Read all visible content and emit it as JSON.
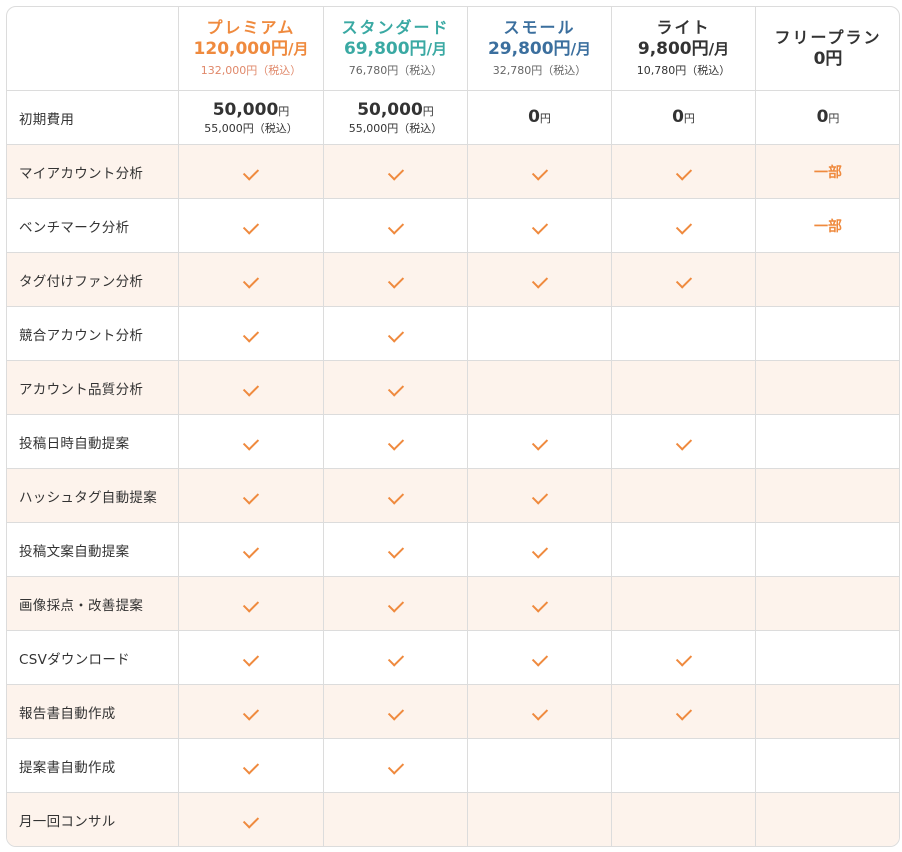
{
  "colors": {
    "accent_orange": "#ef8a3e",
    "standard_teal": "#3aa9a3",
    "small_blue": "#3b6f9e",
    "dark_text": "#333333",
    "stripe_bg": "#fdf3ec",
    "border": "#dcdcdc"
  },
  "plans": [
    {
      "name": "プレミアム",
      "price": "120,000円",
      "unit": "/月",
      "tax": "132,000円（税込）",
      "color": "#ef8a3e",
      "tax_color": "#e0886a"
    },
    {
      "name": "スタンダード",
      "price": "69,800円",
      "unit": "/月",
      "tax": "76,780円（税込）",
      "color": "#3aa9a3",
      "tax_color": "#666666"
    },
    {
      "name": "スモール",
      "price": "29,800円",
      "unit": "/月",
      "tax": "32,780円（税込）",
      "color": "#3b6f9e",
      "tax_color": "#666666"
    },
    {
      "name": "ライト",
      "price": "9,800円",
      "unit": "/月",
      "tax": "10,780円（税込）",
      "color": "#333333",
      "tax_color": "#333333"
    },
    {
      "name": "フリープラン",
      "price": "0円",
      "unit": "",
      "tax": "",
      "color": "#333333",
      "tax_color": "#333333"
    }
  ],
  "initial_fee": {
    "label": "初期費用",
    "values": [
      {
        "amount": "50,000",
        "yen": "円",
        "tax": "55,000円（税込）"
      },
      {
        "amount": "50,000",
        "yen": "円",
        "tax": "55,000円（税込）"
      },
      {
        "amount": "0",
        "yen": "円",
        "tax": ""
      },
      {
        "amount": "0",
        "yen": "円",
        "tax": ""
      },
      {
        "amount": "0",
        "yen": "円",
        "tax": ""
      }
    ]
  },
  "partial_label": "一部",
  "check_icon": "check-icon",
  "features": [
    {
      "label": "マイアカウント分析",
      "cells": [
        "check",
        "check",
        "check",
        "check",
        "partial"
      ]
    },
    {
      "label": "ベンチマーク分析",
      "cells": [
        "check",
        "check",
        "check",
        "check",
        "partial"
      ]
    },
    {
      "label": "タグ付けファン分析",
      "cells": [
        "check",
        "check",
        "check",
        "check",
        ""
      ]
    },
    {
      "label": "競合アカウント分析",
      "cells": [
        "check",
        "check",
        "",
        "",
        ""
      ]
    },
    {
      "label": "アカウント品質分析",
      "cells": [
        "check",
        "check",
        "",
        "",
        ""
      ]
    },
    {
      "label": "投稿日時自動提案",
      "cells": [
        "check",
        "check",
        "check",
        "check",
        ""
      ]
    },
    {
      "label": "ハッシュタグ自動提案",
      "cells": [
        "check",
        "check",
        "check",
        "",
        ""
      ]
    },
    {
      "label": "投稿文案自動提案",
      "cells": [
        "check",
        "check",
        "check",
        "",
        ""
      ]
    },
    {
      "label": "画像採点・改善提案",
      "cells": [
        "check",
        "check",
        "check",
        "",
        ""
      ]
    },
    {
      "label": "CSVダウンロード",
      "cells": [
        "check",
        "check",
        "check",
        "check",
        ""
      ]
    },
    {
      "label": "報告書自動作成",
      "cells": [
        "check",
        "check",
        "check",
        "check",
        ""
      ]
    },
    {
      "label": "提案書自動作成",
      "cells": [
        "check",
        "check",
        "",
        "",
        ""
      ]
    },
    {
      "label": "月一回コンサル",
      "cells": [
        "check",
        "",
        "",
        "",
        ""
      ]
    }
  ]
}
